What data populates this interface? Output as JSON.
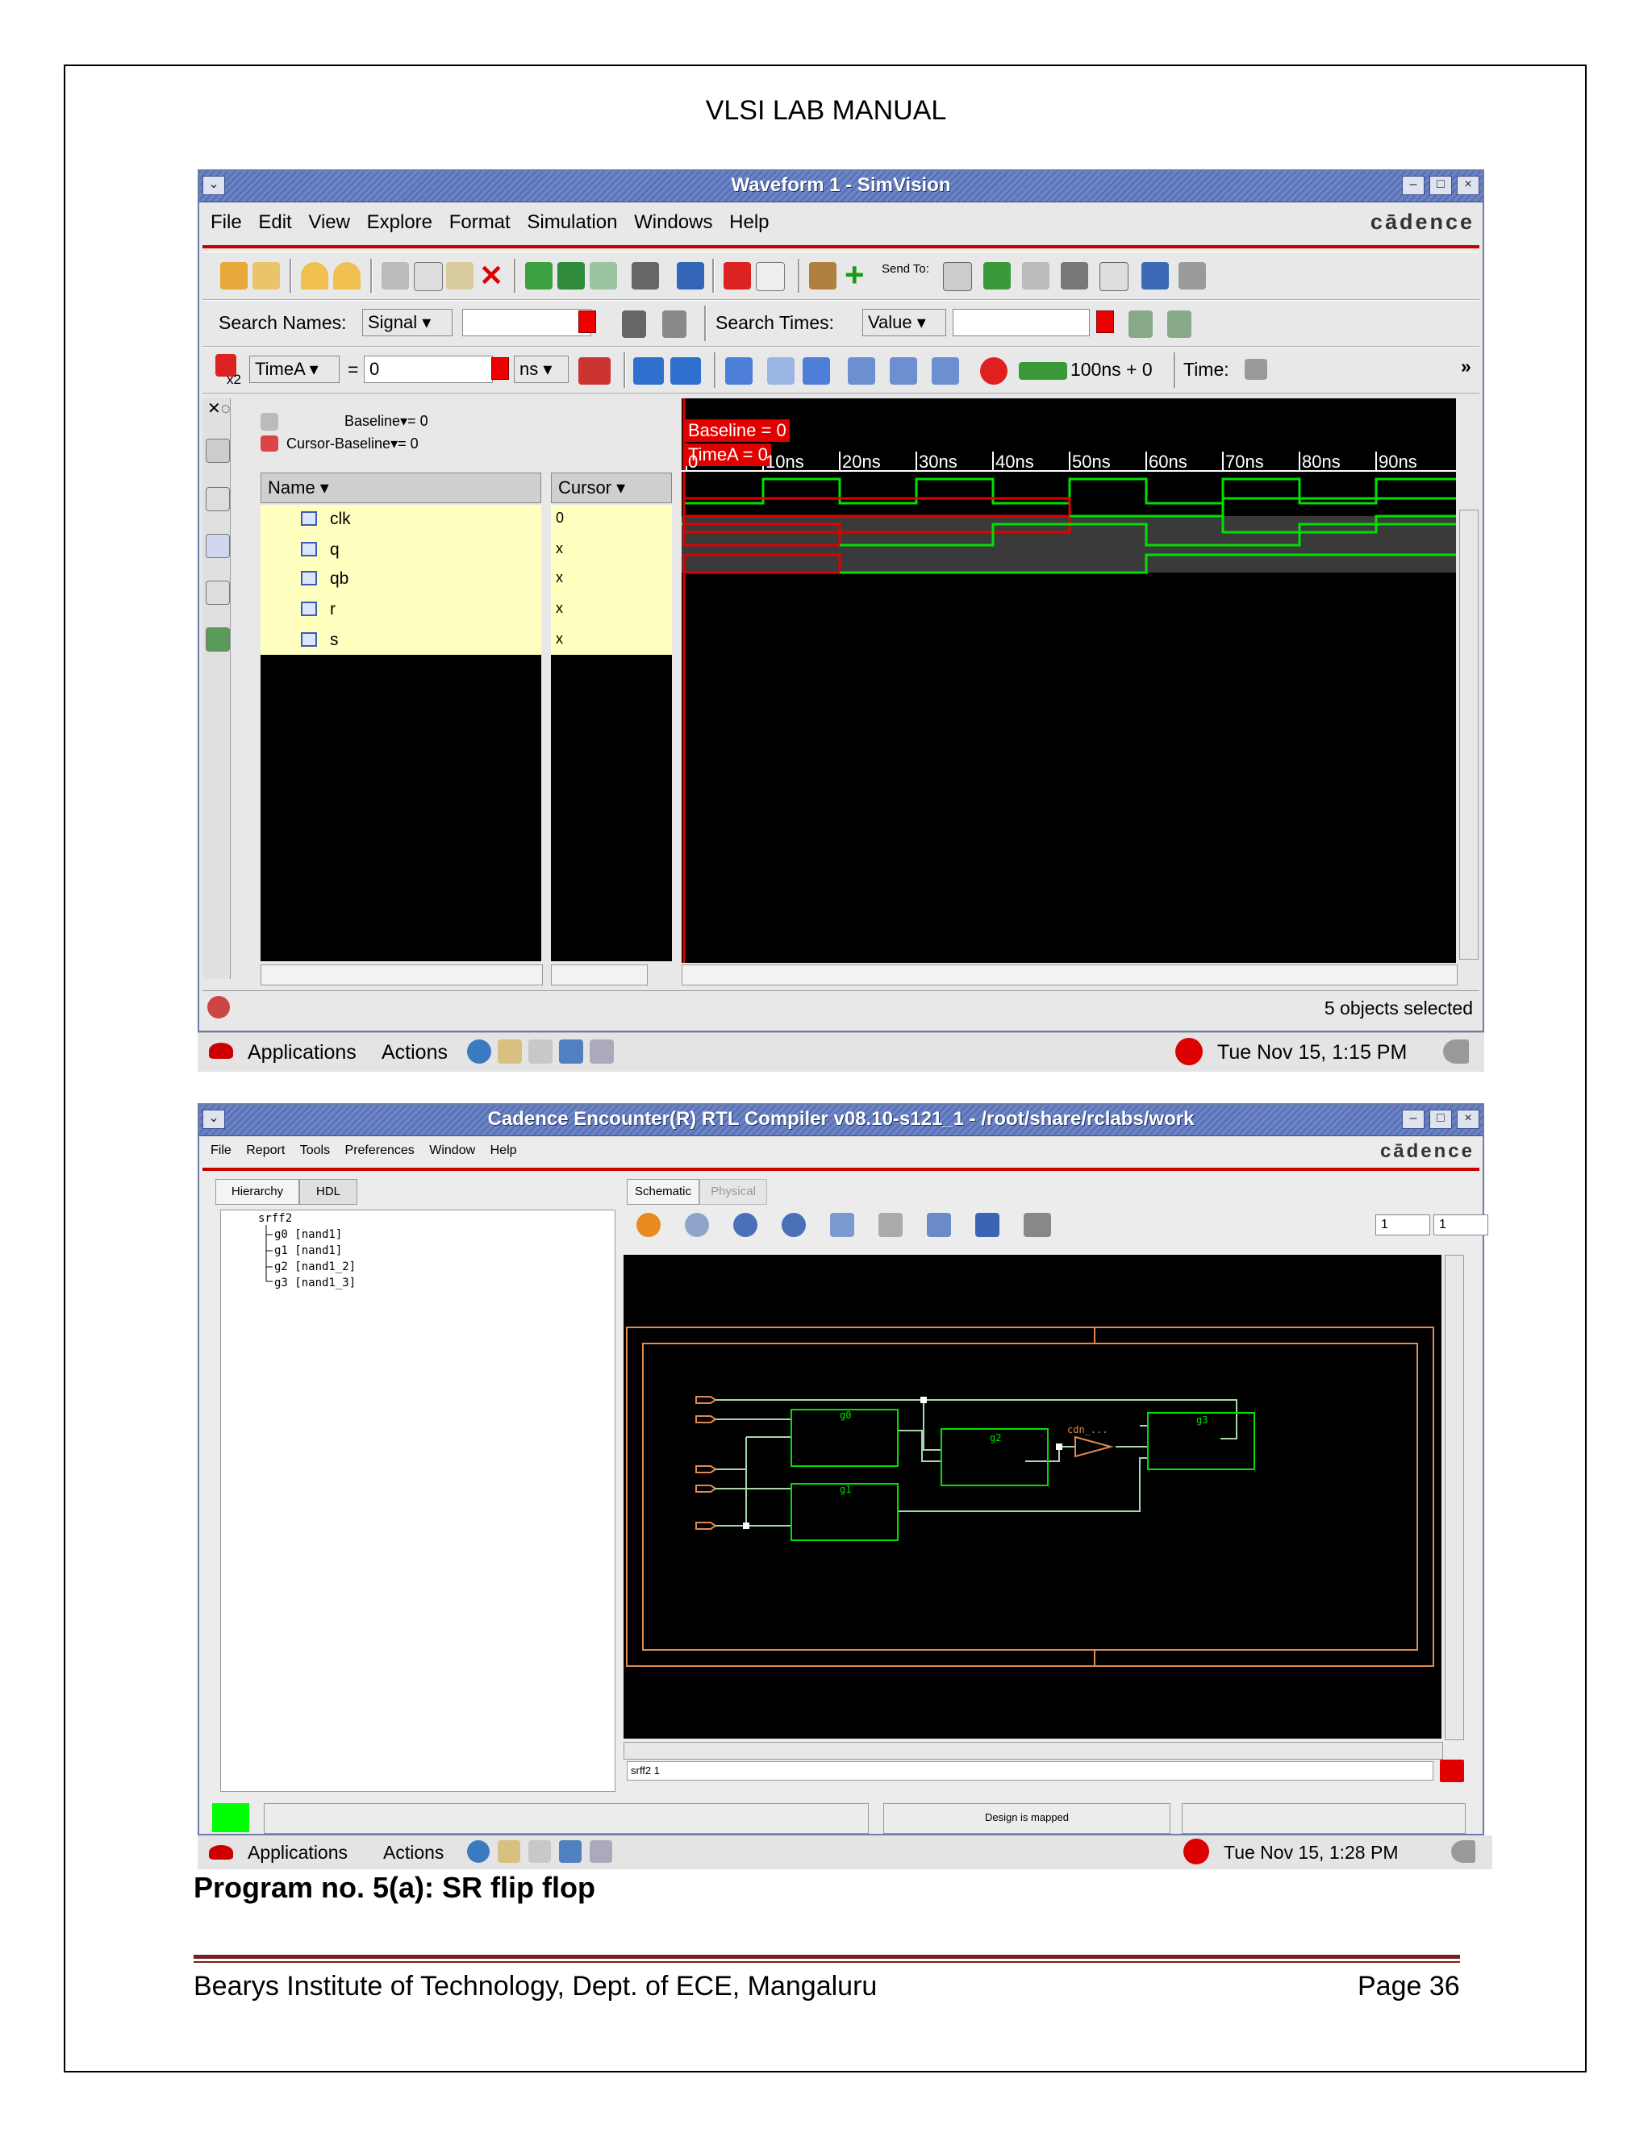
{
  "header": {
    "title": "VLSI LAB MANUAL"
  },
  "window1": {
    "title": "Waveform 1 - SimVision",
    "menu": [
      "File",
      "Edit",
      "View",
      "Explore",
      "Format",
      "Simulation",
      "Windows",
      "Help"
    ],
    "brand": "cādence",
    "send_to_label": "Send To:",
    "search_names_label": "Search Names:",
    "search_names_value": "Signal",
    "search_times_label": "Search Times:",
    "search_times_value": "Value",
    "marker_label": "x2",
    "time_marker": "TimeA",
    "equals": "=",
    "time_value": "0",
    "time_unit": "ns",
    "step_label": "100ns + 0",
    "time_label": "Time:",
    "more": "»",
    "baseline_text": "Baseline",
    "baseline_value": "= 0",
    "cursor_baseline_text": "Cursor-Baseline",
    "cursor_baseline_value": "= 0",
    "col_name": "Name",
    "col_cursor": "Cursor",
    "signals": [
      {
        "name": "clk",
        "cursor": "0"
      },
      {
        "name": "q",
        "cursor": "x"
      },
      {
        "name": "qb",
        "cursor": "x"
      },
      {
        "name": "r",
        "cursor": "x"
      },
      {
        "name": "s",
        "cursor": "x"
      }
    ],
    "baseline_badge": "Baseline = 0",
    "timea_badge": "TimeA = 0",
    "ticks": [
      "0",
      "10ns",
      "20ns",
      "30ns",
      "40ns",
      "50ns",
      "60ns",
      "70ns",
      "80ns",
      "90ns"
    ],
    "status": "5 objects selected"
  },
  "taskbar1": {
    "apps": "Applications",
    "actions": "Actions",
    "clock": "Tue Nov 15,  1:15 PM"
  },
  "window2": {
    "title": "Cadence Encounter(R) RTL Compiler v08.10-s121_1 - /root/share/rclabs/work",
    "menu": [
      "File",
      "Report",
      "Tools",
      "Preferences",
      "Window",
      "Help"
    ],
    "brand": "cādence",
    "tabs_left": [
      "Hierarchy",
      "HDL"
    ],
    "tabs_right": [
      "Schematic",
      "Physical"
    ],
    "tree": [
      "srff2",
      "g0 [nand1]",
      "g1 [nand1]",
      "g2 [nand1_2]",
      "g3 [nand1_3]"
    ],
    "page_a": "1",
    "page_b": "1",
    "gates": [
      "g0",
      "g1",
      "g2",
      "g3"
    ],
    "buffer_label": "cdn_...",
    "path": "srff2 1",
    "status": "Design is mapped"
  },
  "taskbar2": {
    "apps": "Applications",
    "actions": "Actions",
    "clock": "Tue Nov 15,  1:28 PM"
  },
  "caption": "Program no. 5(a):  SR flip flop",
  "footer": {
    "left": "Bearys Institute of Technology, Dept. of ECE, Mangaluru",
    "right": "Page 36"
  },
  "colors": {
    "accent_red": "#c80000",
    "wave_green": "#00e000",
    "wave_red": "#e00000",
    "title_blue": "#5a73b8"
  }
}
